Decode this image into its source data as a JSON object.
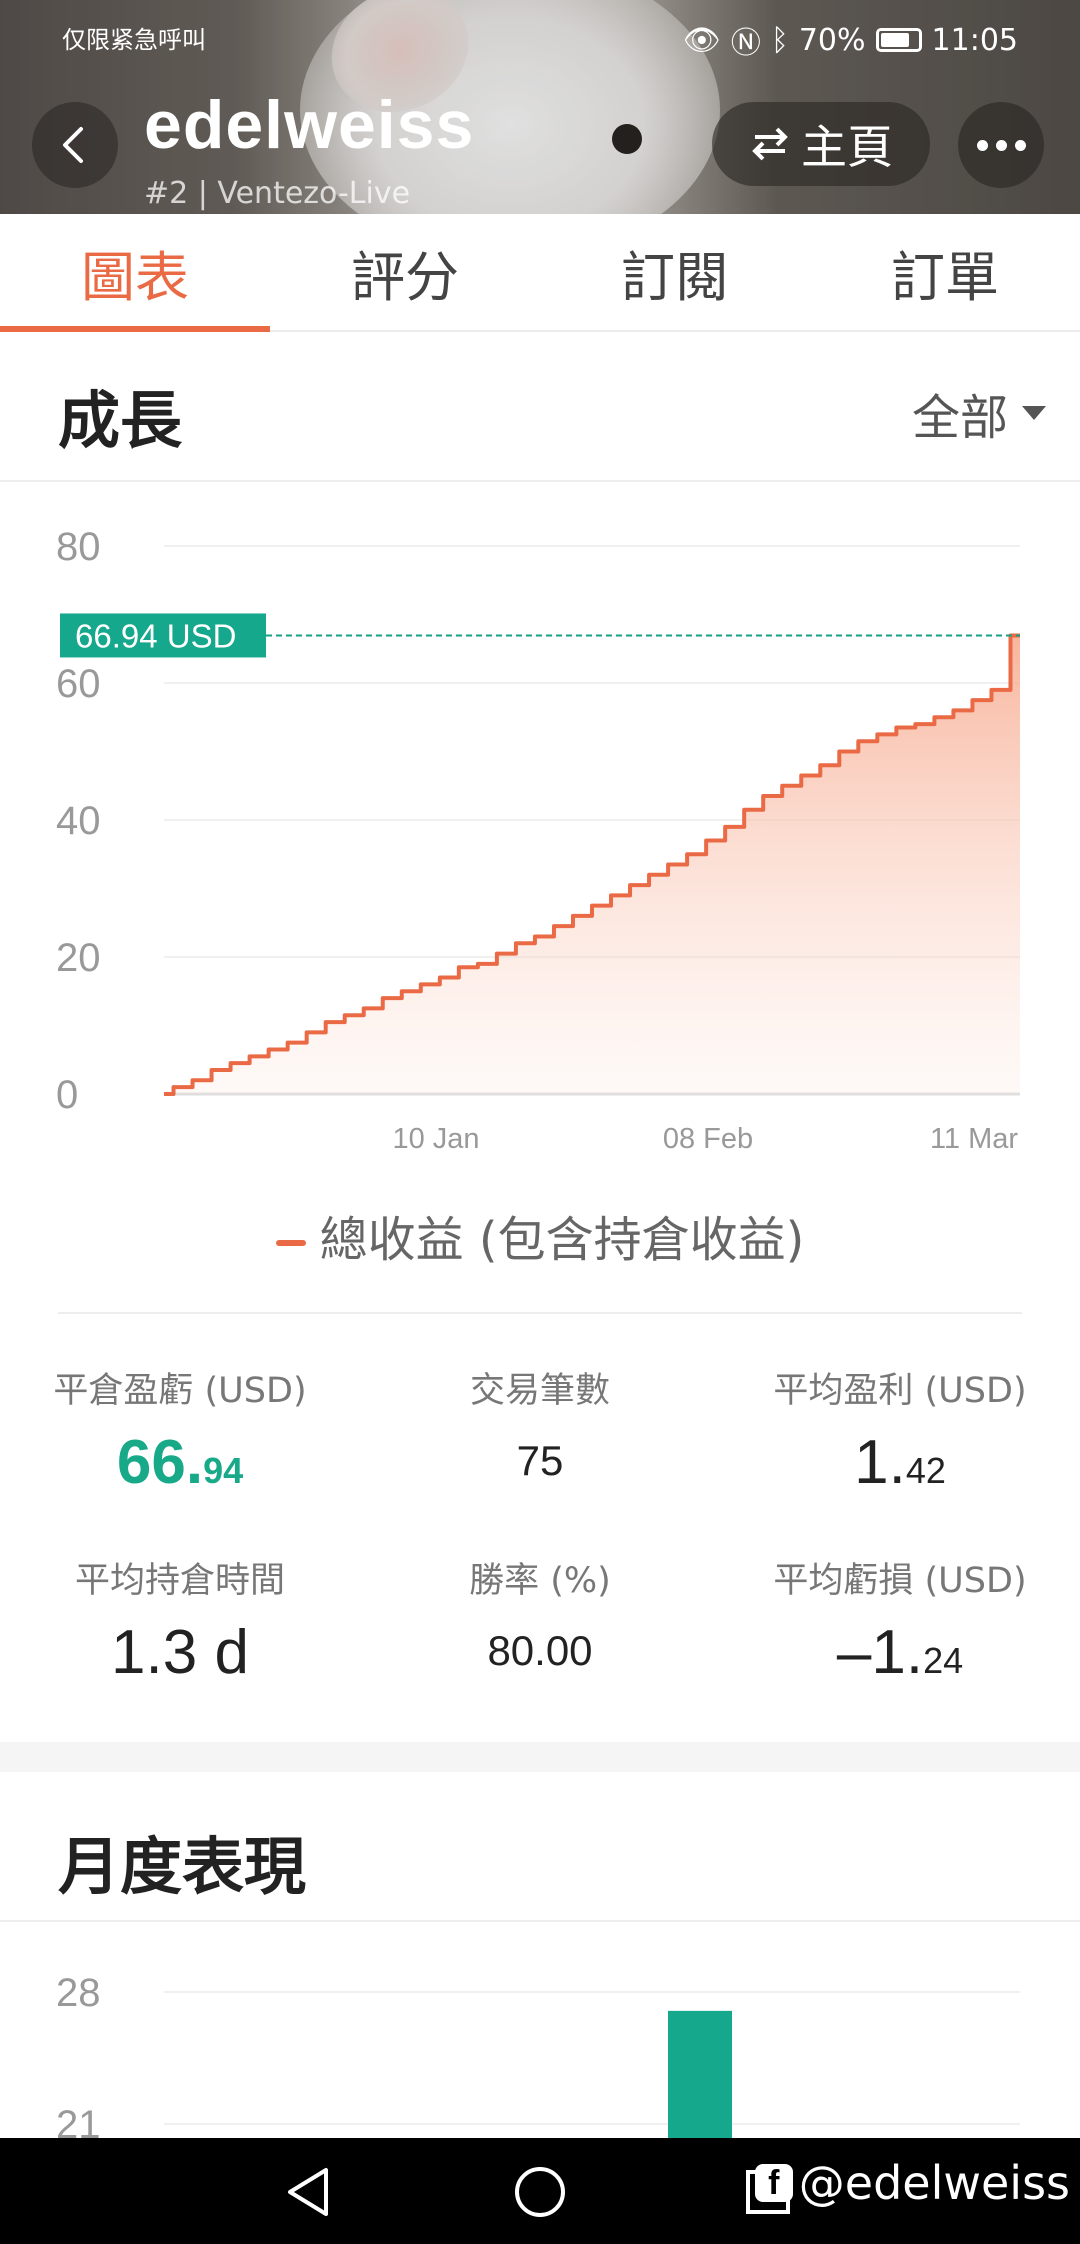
{
  "status_bar": {
    "carrier": "仅限紧急呼叫",
    "battery": "70%",
    "time": "11:05"
  },
  "header": {
    "name": "edelweiss",
    "subtitle": "#2 | Ventezo-Live",
    "home_label": "主頁",
    "back_icon": "chevron-left-icon",
    "swap_icon": "swap-arrows-icon",
    "more_icon": "more-dots-icon"
  },
  "tabs": [
    {
      "label": "圖表",
      "active": true
    },
    {
      "label": "評分",
      "active": false
    },
    {
      "label": "訂閱",
      "active": false
    },
    {
      "label": "訂單",
      "active": false
    }
  ],
  "growth": {
    "title": "成長",
    "filter": "全部",
    "legend": "總收益 (包含持倉收益)",
    "current_label": "66.94 USD"
  },
  "chart_data": [
    {
      "type": "area",
      "title": "成長",
      "ylim": [
        0,
        80
      ],
      "yticks": [
        "80",
        "60",
        "40",
        "20",
        "0"
      ],
      "xticks": [
        "10 Jan",
        "08 Feb",
        "11 Mar"
      ],
      "grid": true,
      "color": "#ea6a45",
      "marker_line": {
        "value": 66.94,
        "label": "66.94 USD",
        "color": "#16a085"
      },
      "series": [
        {
          "name": "總收益 (包含持倉收益)",
          "values": [
            0,
            1,
            2,
            3.5,
            4.5,
            5.5,
            6.5,
            7.5,
            9,
            10.5,
            11.5,
            12.5,
            14,
            15,
            16,
            17,
            18.5,
            19,
            20.5,
            22,
            23,
            24.5,
            26,
            27.5,
            29,
            30.5,
            32,
            33.5,
            35,
            37,
            39,
            41.5,
            43.5,
            45,
            46.5,
            48,
            50,
            51.5,
            52.5,
            53.5,
            54,
            55,
            56,
            57.5,
            59,
            66.94
          ]
        }
      ]
    },
    {
      "type": "bar",
      "title": "月度表現",
      "yticks": [
        "28",
        "21"
      ],
      "color": "#16a88c",
      "values_partial": [
        27
      ]
    }
  ],
  "stats": {
    "closed_pnl": {
      "label": "平倉盈虧 (USD)",
      "int": "66.",
      "dec": "94"
    },
    "trades": {
      "label": "交易筆數",
      "value": "75"
    },
    "avg_profit": {
      "label": "平均盈利 (USD)",
      "int": "1.",
      "dec": "42"
    },
    "avg_hold": {
      "label": "平均持倉時間",
      "value": "1.3 d"
    },
    "win_rate": {
      "label": "勝率 (%)",
      "value": "80.00"
    },
    "avg_loss": {
      "label": "平均虧損 (USD)",
      "int": "–1.",
      "dec": "24"
    }
  },
  "monthly": {
    "title": "月度表現"
  },
  "watermark": "@edelweiss"
}
